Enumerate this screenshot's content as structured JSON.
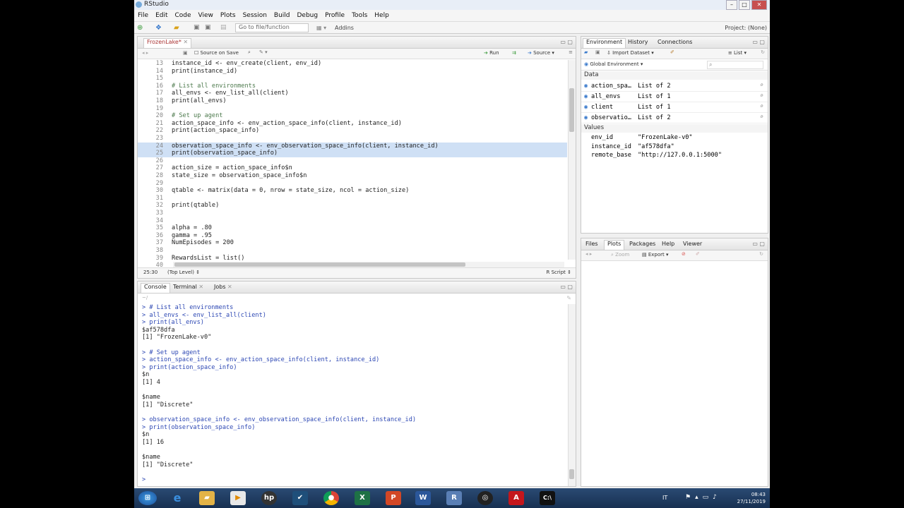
{
  "window": {
    "title": "RStudio"
  },
  "menu": [
    "File",
    "Edit",
    "Code",
    "View",
    "Plots",
    "Session",
    "Build",
    "Debug",
    "Profile",
    "Tools",
    "Help"
  ],
  "toolbar": {
    "goto_placeholder": "Go to file/function",
    "addins": "Addins",
    "project": "Project: (None)"
  },
  "editor": {
    "tab": "FrozenLake*",
    "source_on_save": "Source on Save",
    "run": "Run",
    "source": "Source",
    "status_pos": "25:30",
    "status_scope": "(Top Level)",
    "status_type": "R Script",
    "lines": [
      {
        "n": "13",
        "t": "instance_id <- env_create(client, env_id)",
        "c": false,
        "s": false
      },
      {
        "n": "14",
        "t": "print(instance_id)",
        "c": false,
        "s": false
      },
      {
        "n": "15",
        "t": "",
        "c": false,
        "s": false
      },
      {
        "n": "16",
        "t": "# List all environments",
        "c": true,
        "s": false
      },
      {
        "n": "17",
        "t": "all_envs <- env_list_all(client)",
        "c": false,
        "s": false
      },
      {
        "n": "18",
        "t": "print(all_envs)",
        "c": false,
        "s": false
      },
      {
        "n": "19",
        "t": "",
        "c": false,
        "s": false
      },
      {
        "n": "20",
        "t": "# Set up agent",
        "c": true,
        "s": false
      },
      {
        "n": "21",
        "t": "action_space_info <- env_action_space_info(client, instance_id)",
        "c": false,
        "s": false
      },
      {
        "n": "22",
        "t": "print(action_space_info)",
        "c": false,
        "s": false
      },
      {
        "n": "23",
        "t": "",
        "c": false,
        "s": false
      },
      {
        "n": "24",
        "t": "observation_space_info <- env_observation_space_info(client, instance_id)",
        "c": false,
        "s": true
      },
      {
        "n": "25",
        "t": "print(observation_space_info)",
        "c": false,
        "s": true
      },
      {
        "n": "26",
        "t": "",
        "c": false,
        "s": false
      },
      {
        "n": "27",
        "t": "action_size = action_space_info$n",
        "c": false,
        "s": false
      },
      {
        "n": "28",
        "t": "state_size = observation_space_info$n",
        "c": false,
        "s": false
      },
      {
        "n": "29",
        "t": "",
        "c": false,
        "s": false
      },
      {
        "n": "30",
        "t": "qtable <- matrix(data = 0, nrow = state_size, ncol = action_size)",
        "c": false,
        "s": false
      },
      {
        "n": "31",
        "t": "",
        "c": false,
        "s": false
      },
      {
        "n": "32",
        "t": "print(qtable)",
        "c": false,
        "s": false
      },
      {
        "n": "33",
        "t": "",
        "c": false,
        "s": false
      },
      {
        "n": "34",
        "t": "",
        "c": false,
        "s": false
      },
      {
        "n": "35",
        "t": "alpha = .80",
        "c": false,
        "s": false
      },
      {
        "n": "36",
        "t": "gamma = .95",
        "c": false,
        "s": false
      },
      {
        "n": "37",
        "t": "NumEpisodes = 200",
        "c": false,
        "s": false
      },
      {
        "n": "38",
        "t": "",
        "c": false,
        "s": false
      },
      {
        "n": "39",
        "t": "RewardsList = list()",
        "c": false,
        "s": false
      },
      {
        "n": "40",
        "t": "",
        "c": false,
        "s": false
      }
    ]
  },
  "console": {
    "tabs": [
      "Console",
      "Terminal",
      "Jobs"
    ],
    "lines": [
      {
        "t": "> # List all environments",
        "k": "cmd"
      },
      {
        "t": "> all_envs <- env_list_all(client)",
        "k": "cmd"
      },
      {
        "t": "> print(all_envs)",
        "k": "cmd"
      },
      {
        "t": "$af578dfa",
        "k": "out"
      },
      {
        "t": "[1] \"FrozenLake-v0\"",
        "k": "out"
      },
      {
        "t": "",
        "k": "out"
      },
      {
        "t": "> # Set up agent",
        "k": "cmd"
      },
      {
        "t": "> action_space_info <- env_action_space_info(client, instance_id)",
        "k": "cmd"
      },
      {
        "t": "> print(action_space_info)",
        "k": "cmd"
      },
      {
        "t": "$n",
        "k": "out"
      },
      {
        "t": "[1] 4",
        "k": "out"
      },
      {
        "t": "",
        "k": "out"
      },
      {
        "t": "$name",
        "k": "out"
      },
      {
        "t": "[1] \"Discrete\"",
        "k": "out"
      },
      {
        "t": "",
        "k": "out"
      },
      {
        "t": "> observation_space_info <- env_observation_space_info(client, instance_id)",
        "k": "cmd"
      },
      {
        "t": "> print(observation_space_info)",
        "k": "cmd"
      },
      {
        "t": "$n",
        "k": "out"
      },
      {
        "t": "[1] 16",
        "k": "out"
      },
      {
        "t": "",
        "k": "out"
      },
      {
        "t": "$name",
        "k": "out"
      },
      {
        "t": "[1] \"Discrete\"",
        "k": "out"
      },
      {
        "t": "",
        "k": "out"
      },
      {
        "t": ">",
        "k": "cmd"
      }
    ]
  },
  "environment": {
    "tabs": [
      "Environment",
      "History",
      "Connections"
    ],
    "import": "Import Dataset",
    "list_view": "List",
    "scope": "Global Environment",
    "data_label": "Data",
    "values_label": "Values",
    "data": [
      {
        "name": "action_spa…",
        "value": "List of 2"
      },
      {
        "name": "all_envs",
        "value": "List of 1"
      },
      {
        "name": "client",
        "value": "List of 1"
      },
      {
        "name": "observatio…",
        "value": "List of 2"
      }
    ],
    "values": [
      {
        "name": "env_id",
        "value": "\"FrozenLake-v0\""
      },
      {
        "name": "instance_id",
        "value": "\"af578dfa\""
      },
      {
        "name": "remote_base",
        "value": "\"http://127.0.0.1:5000\""
      }
    ]
  },
  "files": {
    "tabs": [
      "Files",
      "Plots",
      "Packages",
      "Help",
      "Viewer"
    ],
    "zoom": "Zoom",
    "export": "Export"
  },
  "taskbar": {
    "lang": "IT",
    "time": "08:43",
    "date": "27/11/2019"
  }
}
